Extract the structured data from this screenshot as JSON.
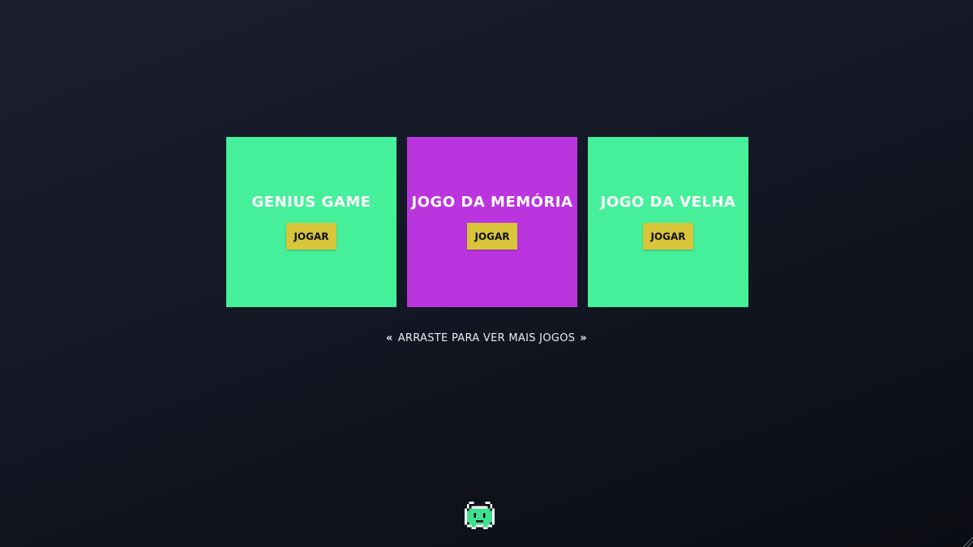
{
  "games": [
    {
      "title": "GENIUS GAME",
      "button_label": "JOGAR",
      "background": "#46f09a"
    },
    {
      "title": "JOGO DA MEMÓRIA",
      "button_label": "JOGAR",
      "background": "#bb35df"
    },
    {
      "title": "JOGO DA VELHA",
      "button_label": "JOGAR",
      "background": "#46f09a"
    }
  ],
  "button_color": "#d8c53a",
  "hint": {
    "text": "ARRASTE PARA VER MAIS JOGOS",
    "left_icon": "double-chevron-left-icon",
    "right_icon": "double-chevron-right-icon"
  },
  "footer_icon": "space-invader-icon",
  "colors": {
    "accent_green": "#46f09a",
    "accent_purple": "#bb35df",
    "button_yellow": "#d8c53a",
    "background_dark": "#141825"
  }
}
